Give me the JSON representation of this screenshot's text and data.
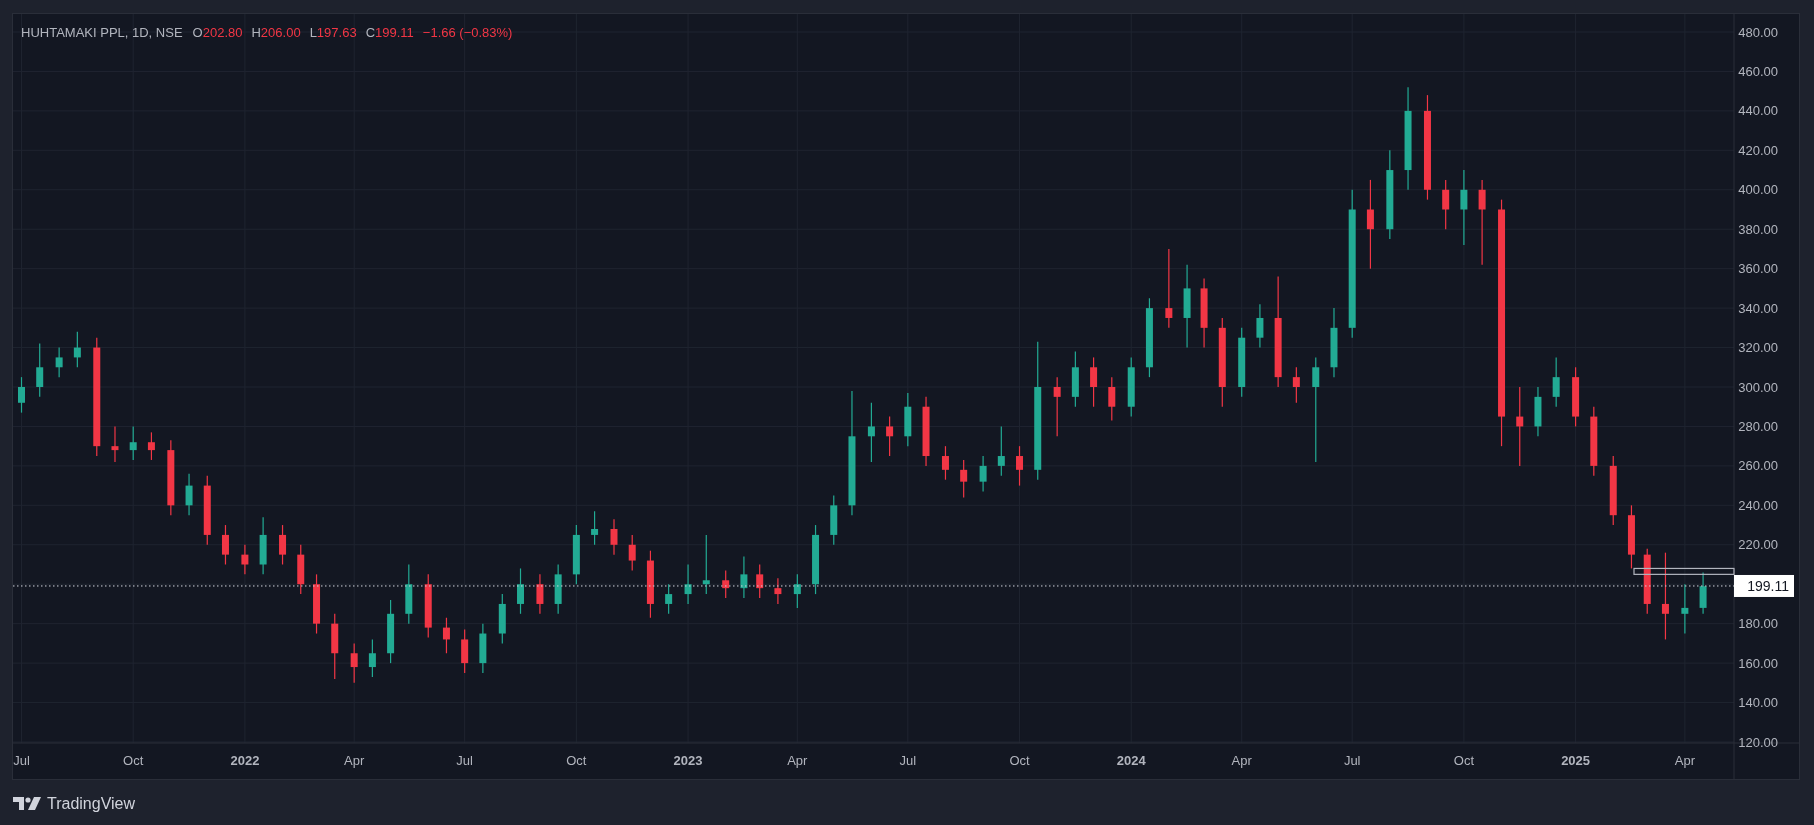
{
  "legend": {
    "symbol": "HUHTAMAKI PPL, 1D, NSE",
    "fields": [
      {
        "label": "O",
        "value": "202.80"
      },
      {
        "label": "H",
        "value": "206.00"
      },
      {
        "label": "L",
        "value": "197.63"
      },
      {
        "label": "C",
        "value": "199.11"
      }
    ],
    "change": "−1.66 (−0.83%)"
  },
  "chart": {
    "chart_data": {
      "type": "candlestick",
      "grid": true,
      "xlim": [
        "2021-06-24",
        "2025-07-04"
      ],
      "ylim": [
        120,
        480
      ],
      "yticks": [
        {
          "value": 120,
          "label": "120.00"
        },
        {
          "value": 140,
          "label": "140.00"
        },
        {
          "value": 160,
          "label": "160.00"
        },
        {
          "value": 180,
          "label": "180.00"
        },
        {
          "value": 220,
          "label": "220.00"
        },
        {
          "value": 240,
          "label": "240.00"
        },
        {
          "value": 260,
          "label": "260.00"
        },
        {
          "value": 280,
          "label": "280.00"
        },
        {
          "value": 300,
          "label": "300.00"
        },
        {
          "value": 320,
          "label": "320.00"
        },
        {
          "value": 340,
          "label": "340.00"
        },
        {
          "value": 360,
          "label": "360.00"
        },
        {
          "value": 380,
          "label": "380.00"
        },
        {
          "value": 400,
          "label": "400.00"
        },
        {
          "value": 420,
          "label": "420.00"
        },
        {
          "value": 440,
          "label": "440.00"
        },
        {
          "value": 460,
          "label": "460.00"
        },
        {
          "value": 480,
          "label": "480.00"
        }
      ],
      "xticks": [
        {
          "value": "2021-07-01",
          "label": "Jul"
        },
        {
          "value": "2021-10-01",
          "label": "Oct"
        },
        {
          "value": "2022-01-01",
          "label": "2022"
        },
        {
          "value": "2022-04-01",
          "label": "Apr"
        },
        {
          "value": "2022-07-01",
          "label": "Jul"
        },
        {
          "value": "2022-10-01",
          "label": "Oct"
        },
        {
          "value": "2023-01-01",
          "label": "2023"
        },
        {
          "value": "2023-04-01",
          "label": "Apr"
        },
        {
          "value": "2023-07-01",
          "label": "Jul"
        },
        {
          "value": "2023-10-01",
          "label": "Oct"
        },
        {
          "value": "2024-01-01",
          "label": "2024"
        },
        {
          "value": "2024-04-01",
          "label": "Apr"
        },
        {
          "value": "2024-07-01",
          "label": "Jul"
        },
        {
          "value": "2024-10-01",
          "label": "Oct"
        },
        {
          "value": "2025-01-01",
          "label": "2025"
        },
        {
          "value": "2025-04-01",
          "label": "Apr"
        }
      ],
      "ref_lines": [
        {
          "axis": "y",
          "value": 199.11,
          "label": "199.11"
        }
      ],
      "x": [
        "2021-07-01",
        "2021-07-16",
        "2021-08-01",
        "2021-08-16",
        "2021-09-01",
        "2021-09-16",
        "2021-10-01",
        "2021-10-16",
        "2021-11-01",
        "2021-11-16",
        "2021-12-01",
        "2021-12-16",
        "2022-01-01",
        "2022-01-16",
        "2022-02-01",
        "2022-02-16",
        "2022-03-01",
        "2022-03-16",
        "2022-04-01",
        "2022-04-16",
        "2022-05-01",
        "2022-05-16",
        "2022-06-01",
        "2022-06-16",
        "2022-07-01",
        "2022-07-16",
        "2022-08-01",
        "2022-08-16",
        "2022-09-01",
        "2022-09-16",
        "2022-10-01",
        "2022-10-16",
        "2022-11-01",
        "2022-11-16",
        "2022-12-01",
        "2022-12-16",
        "2023-01-01",
        "2023-01-16",
        "2023-02-01",
        "2023-02-16",
        "2023-03-01",
        "2023-03-16",
        "2023-04-01",
        "2023-04-16",
        "2023-05-01",
        "2023-05-16",
        "2023-06-01",
        "2023-06-16",
        "2023-07-01",
        "2023-07-16",
        "2023-08-01",
        "2023-08-16",
        "2023-09-01",
        "2023-09-16",
        "2023-10-01",
        "2023-10-16",
        "2023-11-01",
        "2023-11-16",
        "2023-12-01",
        "2023-12-16",
        "2024-01-01",
        "2024-01-16",
        "2024-02-01",
        "2024-02-16",
        "2024-03-01",
        "2024-03-16",
        "2024-04-01",
        "2024-04-16",
        "2024-05-01",
        "2024-05-16",
        "2024-06-01",
        "2024-06-16",
        "2024-07-01",
        "2024-07-16",
        "2024-08-01",
        "2024-08-16",
        "2024-09-01",
        "2024-09-16",
        "2024-10-01",
        "2024-10-16",
        "2024-11-01",
        "2024-11-16",
        "2024-12-01",
        "2024-12-16",
        "2025-01-01",
        "2025-01-16",
        "2025-02-01",
        "2025-02-16",
        "2025-03-01",
        "2025-03-16",
        "2025-04-01",
        "2025-04-16"
      ],
      "ohlc": [
        [
          292,
          305,
          287,
          300
        ],
        [
          300,
          322,
          295,
          310
        ],
        [
          310,
          320,
          305,
          315
        ],
        [
          315,
          328,
          310,
          320
        ],
        [
          320,
          325,
          265,
          270
        ],
        [
          270,
          280,
          262,
          268
        ],
        [
          268,
          280,
          263,
          272
        ],
        [
          272,
          277,
          263,
          268
        ],
        [
          268,
          273,
          235,
          240
        ],
        [
          240,
          256,
          235,
          250
        ],
        [
          250,
          255,
          220,
          225
        ],
        [
          225,
          230,
          210,
          215
        ],
        [
          215,
          220,
          205,
          210
        ],
        [
          210,
          234,
          205,
          225
        ],
        [
          225,
          230,
          210,
          215
        ],
        [
          215,
          220,
          195,
          200
        ],
        [
          200,
          205,
          175,
          180
        ],
        [
          180,
          185,
          152,
          165
        ],
        [
          165,
          170,
          150,
          158
        ],
        [
          158,
          172,
          153,
          165
        ],
        [
          165,
          192,
          160,
          185
        ],
        [
          185,
          210,
          180,
          200
        ],
        [
          200,
          205,
          173,
          178
        ],
        [
          178,
          183,
          165,
          172
        ],
        [
          172,
          177,
          155,
          160
        ],
        [
          160,
          180,
          155,
          175
        ],
        [
          175,
          195,
          170,
          190
        ],
        [
          190,
          208,
          185,
          200
        ],
        [
          200,
          205,
          185,
          190
        ],
        [
          190,
          210,
          185,
          205
        ],
        [
          205,
          230,
          200,
          225
        ],
        [
          225,
          237,
          220,
          228
        ],
        [
          228,
          233,
          215,
          220
        ],
        [
          220,
          225,
          207,
          212
        ],
        [
          212,
          217,
          183,
          190
        ],
        [
          190,
          200,
          185,
          195
        ],
        [
          195,
          210,
          190,
          200
        ],
        [
          200,
          225,
          195,
          202
        ],
        [
          202,
          207,
          193,
          198
        ],
        [
          198,
          214,
          193,
          205
        ],
        [
          205,
          210,
          193,
          198
        ],
        [
          198,
          203,
          190,
          195
        ],
        [
          195,
          205,
          188,
          200
        ],
        [
          200,
          230,
          195,
          225
        ],
        [
          225,
          245,
          220,
          240
        ],
        [
          240,
          298,
          235,
          275
        ],
        [
          275,
          292,
          262,
          280
        ],
        [
          280,
          285,
          265,
          275
        ],
        [
          275,
          297,
          270,
          290
        ],
        [
          290,
          295,
          260,
          265
        ],
        [
          265,
          270,
          253,
          258
        ],
        [
          258,
          263,
          244,
          252
        ],
        [
          252,
          265,
          247,
          260
        ],
        [
          260,
          280,
          255,
          265
        ],
        [
          265,
          270,
          250,
          258
        ],
        [
          258,
          323,
          253,
          300
        ],
        [
          300,
          305,
          275,
          295
        ],
        [
          295,
          318,
          290,
          310
        ],
        [
          310,
          315,
          290,
          300
        ],
        [
          300,
          305,
          283,
          290
        ],
        [
          290,
          315,
          285,
          310
        ],
        [
          310,
          345,
          305,
          340
        ],
        [
          340,
          370,
          330,
          335
        ],
        [
          335,
          362,
          320,
          350
        ],
        [
          350,
          355,
          320,
          330
        ],
        [
          330,
          335,
          290,
          300
        ],
        [
          300,
          330,
          295,
          325
        ],
        [
          325,
          342,
          320,
          335
        ],
        [
          335,
          356,
          300,
          305
        ],
        [
          305,
          310,
          292,
          300
        ],
        [
          300,
          315,
          262,
          310
        ],
        [
          310,
          340,
          305,
          330
        ],
        [
          330,
          400,
          325,
          390
        ],
        [
          390,
          405,
          360,
          380
        ],
        [
          380,
          420,
          375,
          410
        ],
        [
          410,
          452,
          400,
          440
        ],
        [
          440,
          448,
          395,
          400
        ],
        [
          400,
          405,
          380,
          390
        ],
        [
          390,
          410,
          372,
          400
        ],
        [
          400,
          405,
          362,
          390
        ],
        [
          390,
          395,
          270,
          285
        ],
        [
          285,
          300,
          260,
          280
        ],
        [
          280,
          300,
          275,
          295
        ],
        [
          295,
          315,
          290,
          305
        ],
        [
          305,
          310,
          280,
          285
        ],
        [
          285,
          290,
          255,
          260
        ],
        [
          260,
          265,
          230,
          235
        ],
        [
          235,
          240,
          208,
          215
        ],
        [
          215,
          218,
          185,
          190
        ],
        [
          190,
          216,
          172,
          185
        ],
        [
          185,
          200,
          175,
          188
        ],
        [
          188,
          206,
          185,
          199
        ]
      ]
    }
  },
  "footer": {
    "brand": "TradingView"
  }
}
